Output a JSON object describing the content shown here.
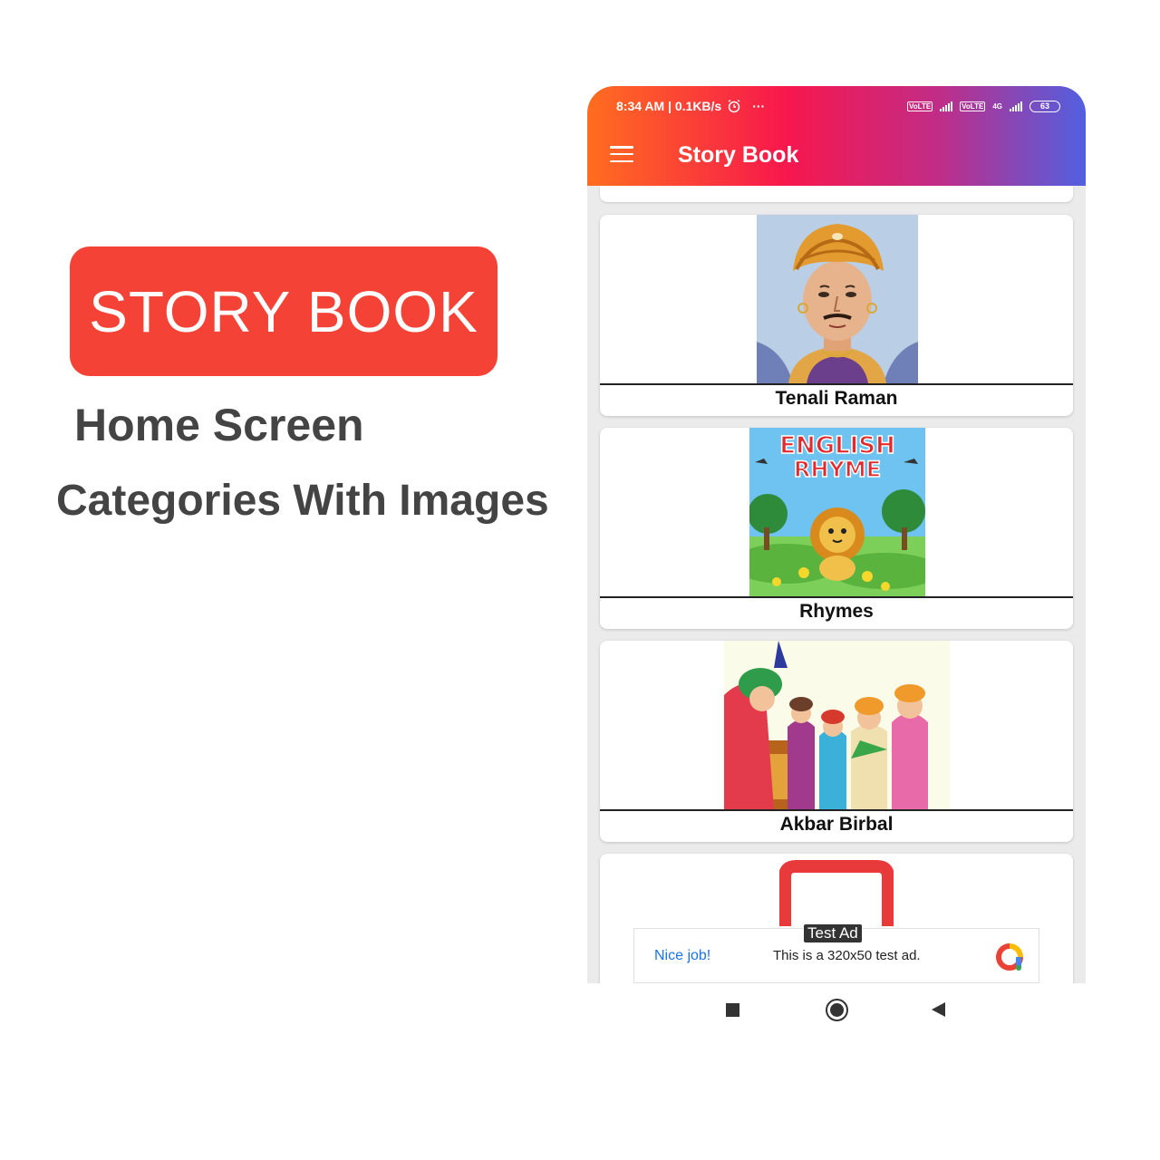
{
  "promo": {
    "badge": "STORY BOOK",
    "subtitle_1": "Home Screen",
    "subtitle_2": "Categories With Images"
  },
  "status_bar": {
    "time_speed": "8:34 AM | 0.1KB/s",
    "more": "···",
    "network_1": "VoLTE",
    "network_2": "VoLTE",
    "network_3": "4G",
    "battery": "63"
  },
  "app_bar": {
    "title": "Story Book",
    "menu_icon": "hamburger-menu-icon"
  },
  "categories": [
    {
      "label": "Tenali Raman",
      "image": "tenali-raman-portrait"
    },
    {
      "label": "Rhymes",
      "image": "english-rhyme-cover"
    },
    {
      "label": "Akbar Birbal",
      "image": "akbar-birbal-court"
    },
    {
      "label": "",
      "image": "red-icon-partial"
    }
  ],
  "rhyme_cover": {
    "line_1": "ENGLISH",
    "line_2": "RHYME"
  },
  "ad": {
    "tag": "Test Ad",
    "headline": "Nice job!",
    "body": "This is a 320x50 test ad.",
    "logo": "ads-logo-icon"
  },
  "nav": {
    "recents": "recents-icon",
    "home": "home-icon",
    "back": "back-icon"
  },
  "colors": {
    "badge": "#f44336",
    "gradient": [
      "#ff6d1f",
      "#f7174d",
      "#c22c86",
      "#5160e0"
    ],
    "content_bg": "#ecebeb"
  }
}
